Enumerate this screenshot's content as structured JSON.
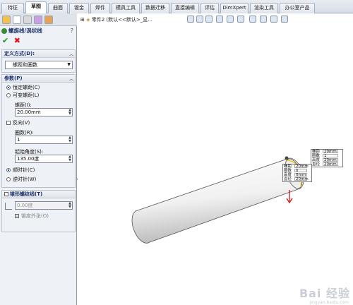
{
  "tabs": [
    "特征",
    "草图",
    "曲面",
    "钣金",
    "焊件",
    "模具工具",
    "数据迁移",
    "直接编辑",
    "评估",
    "DimXpert",
    "渲染工具",
    "办公室产品"
  ],
  "active_tab": "草图",
  "panel": {
    "title": "螺旋线/涡状线",
    "help": "?",
    "ok": "✔",
    "cancel": "✖",
    "defined_by": {
      "title": "定义方式(D):",
      "value": "螺距和圈数"
    },
    "params": {
      "title": "参数(P)",
      "constant_pitch": "恒定螺距(C)",
      "variable_pitch": "可变螺距(L)",
      "pitch_label": "螺距(I):",
      "pitch_value": "20.00mm",
      "reverse": "反向(V)",
      "revolutions_label": "圈数(R):",
      "revolutions_value": "1",
      "start_angle_label": "起始角度(S):",
      "start_angle_value": "135.00度",
      "clockwise": "顺时针(C)",
      "counterclockwise": "逆时针(W)"
    },
    "taper": {
      "title": "锥形螺纹线(T)",
      "angle_value": "0.00度",
      "taper_outward": "锥度外张(O)"
    }
  },
  "viewport": {
    "tree_path": "零件2 (默认<<默认>_显..."
  },
  "callout_top": [
    {
      "k": "螺距",
      "v": "20mm"
    },
    {
      "k": "圈数",
      "v": "1"
    },
    {
      "k": "高度",
      "v": "20mm"
    },
    {
      "k": "直径",
      "v": "20mm"
    }
  ],
  "callout_mid": [
    {
      "k": "螺距",
      "v": "20mm"
    },
    {
      "k": "圈数",
      "v": "0"
    },
    {
      "k": "高度",
      "v": "0mm"
    },
    {
      "k": "直径",
      "v": "20mm"
    }
  ],
  "watermark": "Bai 经验",
  "watermark_sub": "jingyan.baidu.com",
  "colors": {
    "panel_bg": "#eef1f5",
    "title_color": "#1b2f6b",
    "ok_green": "#1c8f1c",
    "cancel_red": "#d11111",
    "cylinder_shade": "#c8c8c8"
  },
  "icons": [
    "feature-manager-icon",
    "property-manager-icon",
    "configuration-manager-icon",
    "dimxpert-manager-icon",
    "display-manager-icon"
  ]
}
